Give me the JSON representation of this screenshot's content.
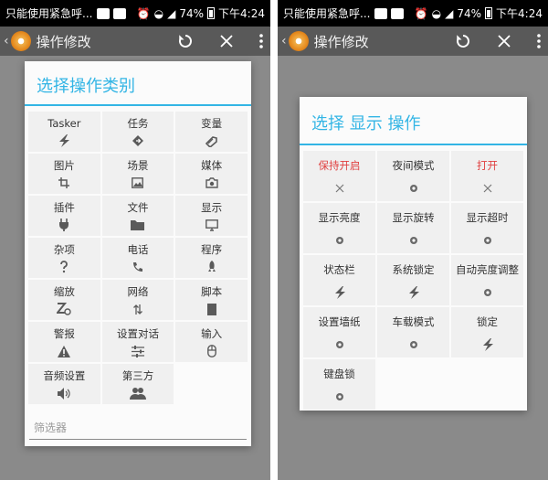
{
  "status_bar": {
    "notification_text": "只能使用紧急呼...",
    "battery": "74%",
    "time": "下午4:24"
  },
  "app_bar": {
    "title": "操作修改"
  },
  "left_dialog": {
    "title": "选择操作类别",
    "filter_placeholder": "筛选器",
    "items": [
      {
        "label": "Tasker",
        "icon": "lightning-icon"
      },
      {
        "label": "任务",
        "icon": "diamond-arrow-icon"
      },
      {
        "label": "变量",
        "icon": "tag-icon"
      },
      {
        "label": "图片",
        "icon": "crop-icon"
      },
      {
        "label": "场景",
        "icon": "image-icon"
      },
      {
        "label": "媒体",
        "icon": "camera-icon"
      },
      {
        "label": "插件",
        "icon": "plug-icon"
      },
      {
        "label": "文件",
        "icon": "folder-icon"
      },
      {
        "label": "显示",
        "icon": "monitor-icon"
      },
      {
        "label": "杂项",
        "icon": "question-icon"
      },
      {
        "label": "电话",
        "icon": "phone-icon"
      },
      {
        "label": "程序",
        "icon": "rocket-icon"
      },
      {
        "label": "缩放",
        "icon": "zoom-z-icon"
      },
      {
        "label": "网络",
        "icon": "transfer-arrows-icon"
      },
      {
        "label": "脚本",
        "icon": "document-icon"
      },
      {
        "label": "警报",
        "icon": "warning-icon"
      },
      {
        "label": "设置对话",
        "icon": "sliders-icon"
      },
      {
        "label": "输入",
        "icon": "mouse-icon"
      },
      {
        "label": "音频设置",
        "icon": "speaker-icon"
      },
      {
        "label": "第三方",
        "icon": "people-icon"
      }
    ]
  },
  "right_dialog": {
    "title": "选择 显示 操作",
    "items": [
      {
        "label": "保持开启",
        "icon": "close-icon",
        "red": true
      },
      {
        "label": "夜间模式",
        "icon": "dot-icon",
        "red": false
      },
      {
        "label": "打开",
        "icon": "close-icon",
        "red": true
      },
      {
        "label": "显示亮度",
        "icon": "dot-icon",
        "red": false
      },
      {
        "label": "显示旋转",
        "icon": "dot-icon",
        "red": false
      },
      {
        "label": "显示超时",
        "icon": "dot-icon",
        "red": false
      },
      {
        "label": "状态栏",
        "icon": "lightning-icon",
        "red": false
      },
      {
        "label": "系统锁定",
        "icon": "lightning-icon",
        "red": false
      },
      {
        "label": "自动亮度调整",
        "icon": "dot-icon",
        "red": false
      },
      {
        "label": "设置墙纸",
        "icon": "dot-icon",
        "red": false
      },
      {
        "label": "车载模式",
        "icon": "dot-icon",
        "red": false
      },
      {
        "label": "锁定",
        "icon": "lightning-icon",
        "red": false
      },
      {
        "label": "键盘锁",
        "icon": "dot-icon",
        "red": false
      }
    ]
  },
  "colors": {
    "accent": "#33b5e5",
    "warning_red": "#e04040",
    "app_bar": "#595959"
  }
}
